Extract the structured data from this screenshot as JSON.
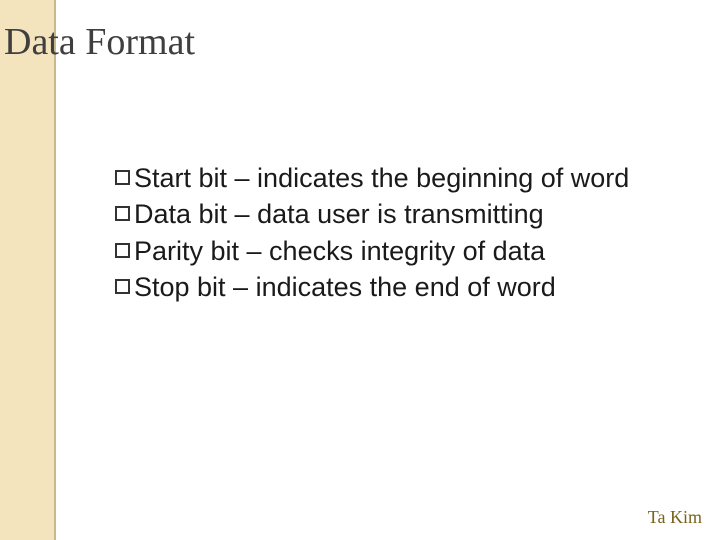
{
  "title": "Data Format",
  "bullets": [
    "Start bit – indicates the beginning of word",
    "Data bit – data user is transmitting",
    "Parity bit – checks integrity of data",
    "Stop bit – indicates the end of word"
  ],
  "footer": "Ta Kim"
}
